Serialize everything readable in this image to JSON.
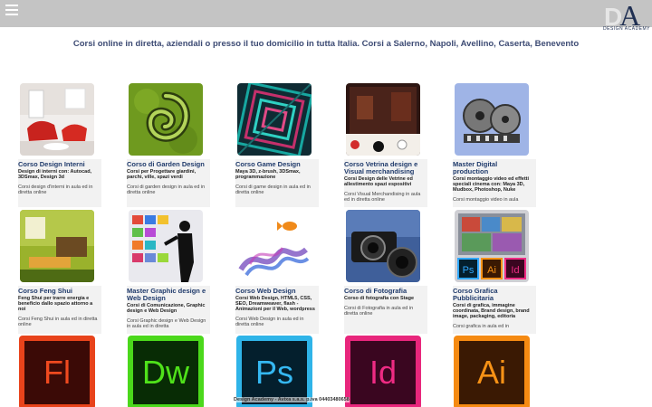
{
  "header": {
    "menu_icon": "hamburger-icon",
    "logo_sub": "DESIGN ACADEMY"
  },
  "headline": "Corsi online in diretta, aziendali o presso il tuo domicilio in tutta Italia. Corsi a Salerno, Napoli, Avellino, Caserta, Benevento",
  "courses": [
    {
      "title": "Corso Design Interni",
      "subtitle": "Design di interni con: Autocad, 3DSmax, Design 3d",
      "desc": "Corsi design d'interni in aula ed in diretta online"
    },
    {
      "title": "Corso di Garden Design",
      "subtitle": "Corsi per Progettare giardini, parchi, ville, spazi verdi",
      "desc": "Corsi di garden design in aula ed in diretta online"
    },
    {
      "title": "Corso Game Design",
      "subtitle": "Maya 3D, z-brush, 3DSmax, programmazione",
      "desc": "Corsi di game design in aula ed in diretta online"
    },
    {
      "title": "Corso Vetrina design e Visual merchandising",
      "subtitle": "Corsi Design delle Vetrine ed allestimento spazi espositivi",
      "desc": "Corsi Visual Merchandising in aula ed in diretta online"
    },
    {
      "title": "Master Digital production",
      "subtitle": "Corsi montaggio video ed effetti speciali cinema con: Maya 3D, Mudbox, Photoshop, Nuke",
      "desc": "Corsi montaggio video in aula"
    },
    {
      "title": "Corso Feng Shui",
      "subtitle": "Feng Shui per trarre energia e beneficio dallo spazio attorno a noi",
      "desc": "Corsi Feng Shui in aula ed in diretta online"
    },
    {
      "title": "Master Graphic design e Web Design",
      "subtitle": "Corsi di Comunicazione, Graphic design e Web Design",
      "desc": "Corsi Graphic design e Web Design in aula ed in diretta"
    },
    {
      "title": "Corso Web Design",
      "subtitle": "Corsi Web Design, HTML5, CSS, SEO, Dreamweaver, flash - Animazioni per il Web, wordpress",
      "desc": "Corsi Web Design in aula ed in diretta online"
    },
    {
      "title": "Corso di Fotografia",
      "subtitle": "Corso di fotografia con Stage",
      "desc": "Corsi di Fotografia in aula ed in diretta online"
    },
    {
      "title": "Corso Grafica Pubblicitaria",
      "subtitle": "Corsi di grafica, immagine coordinata, Brand design, brand image, packaging, editoria",
      "desc": "Corsi grafica in aula ed in"
    }
  ],
  "icons": [
    {
      "label": "Fl",
      "name": "flash-icon",
      "bg": "#e8431b",
      "inner": "#3b0a06",
      "fg": "#f04a1f"
    },
    {
      "label": "Dw",
      "name": "dreamweaver-icon",
      "bg": "#4bd81b",
      "inner": "#082c05",
      "fg": "#4fe21a"
    },
    {
      "label": "Ps",
      "name": "photoshop-icon",
      "bg": "#2fb4e8",
      "inner": "#041f2d",
      "fg": "#35b8f2"
    },
    {
      "label": "Id",
      "name": "indesign-icon",
      "bg": "#e8267c",
      "inner": "#3a0620",
      "fg": "#ee2b83"
    },
    {
      "label": "Ai",
      "name": "illustrator-icon",
      "bg": "#f58a12",
      "inner": "#3a1903",
      "fg": "#f79216"
    }
  ],
  "mini_icons": [
    "Ps",
    "Ai",
    "Id"
  ],
  "footer": "Design Academy - Avixa s.a.s. p.iva 04403480658"
}
